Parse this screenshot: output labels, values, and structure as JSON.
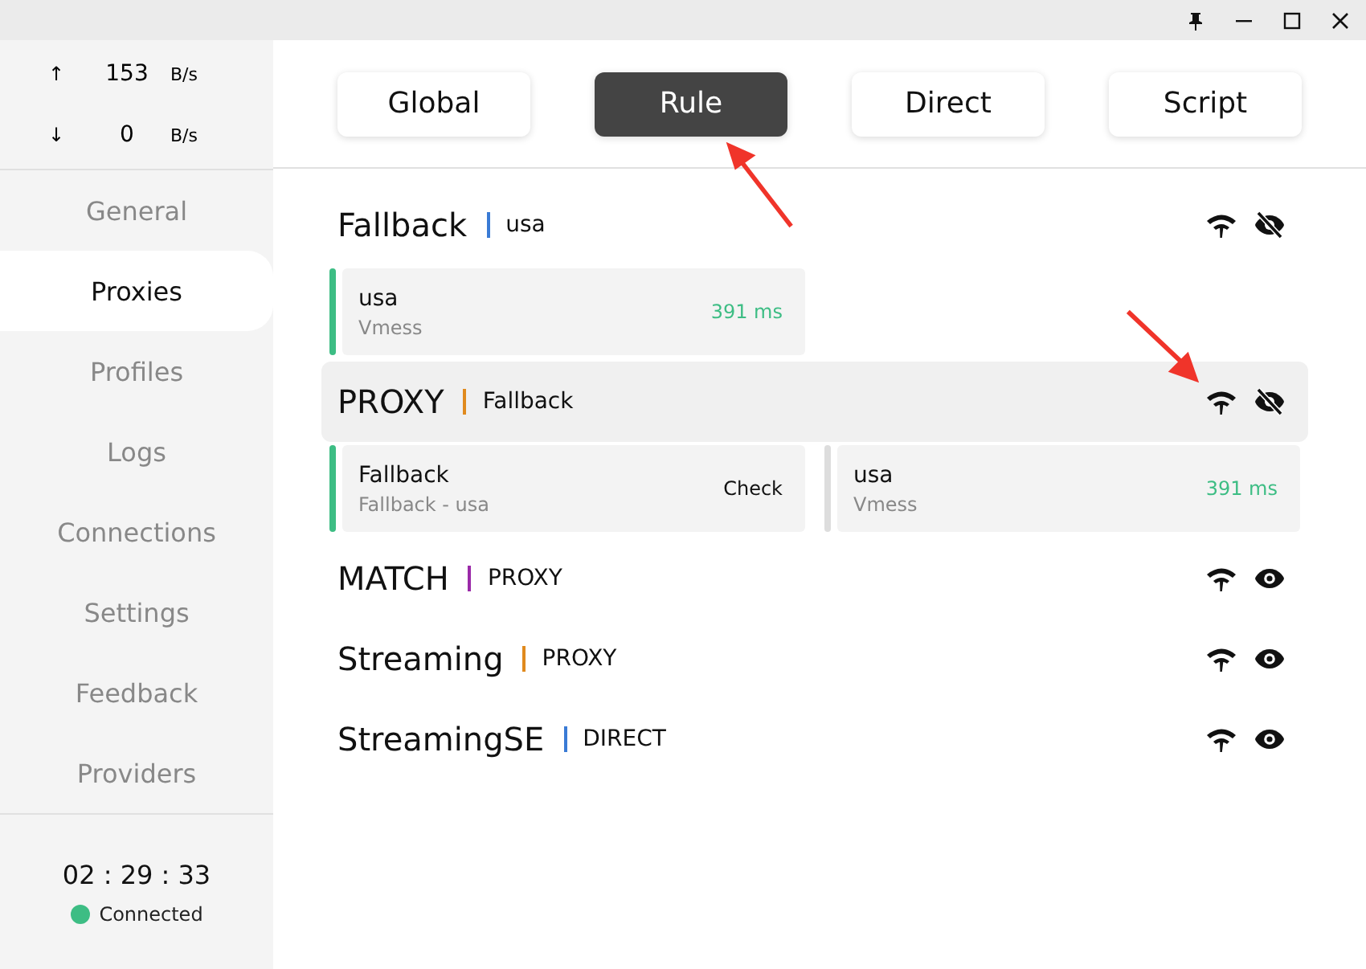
{
  "titlebar": {
    "buttons": [
      {
        "kind": "pin"
      },
      {
        "kind": "minimize"
      },
      {
        "kind": "maximize"
      },
      {
        "kind": "close"
      }
    ]
  },
  "traffic": {
    "up": {
      "arrow": "↑",
      "value": "153",
      "unit": "B/s"
    },
    "down": {
      "arrow": "↓",
      "value": "0",
      "unit": "B/s"
    }
  },
  "sidebar": {
    "items": [
      {
        "label": "General",
        "selected": false
      },
      {
        "label": "Proxies",
        "selected": true
      },
      {
        "label": "Profiles",
        "selected": false
      },
      {
        "label": "Logs",
        "selected": false
      },
      {
        "label": "Connections",
        "selected": false
      },
      {
        "label": "Settings",
        "selected": false
      },
      {
        "label": "Feedback",
        "selected": false
      },
      {
        "label": "Providers",
        "selected": false
      }
    ]
  },
  "status": {
    "uptime": "02 : 29 : 33",
    "label": "Connected",
    "color": "#3dbd84"
  },
  "modes": [
    {
      "label": "Global",
      "selected": false
    },
    {
      "label": "Rule",
      "selected": true
    },
    {
      "label": "Direct",
      "selected": false
    },
    {
      "label": "Script",
      "selected": false
    }
  ],
  "groups": [
    {
      "name": "Fallback",
      "now": "usa",
      "color": "#3a7bd5",
      "hovered": false,
      "expanded": true,
      "proxies": [
        {
          "name": "usa",
          "subtitle": "Vmess",
          "kind": "delay",
          "delay": "391 ms",
          "selected": true
        }
      ]
    },
    {
      "name": "PROXY",
      "now": "Fallback",
      "color": "#e08a1e",
      "hovered": true,
      "expanded": true,
      "proxies": [
        {
          "name": "Fallback",
          "subtitle": "Fallback - usa",
          "kind": "check",
          "delay": "Check",
          "selected": true
        },
        {
          "name": "usa",
          "subtitle": "Vmess",
          "kind": "delay",
          "delay": "391 ms",
          "selected": false
        }
      ]
    },
    {
      "name": "MATCH",
      "now": "PROXY",
      "color": "#9b2aa8",
      "hovered": false,
      "expanded": false
    },
    {
      "name": "Streaming",
      "now": "PROXY",
      "color": "#e08a1e",
      "hovered": false,
      "expanded": false
    },
    {
      "name": "StreamingSE",
      "now": "DIRECT",
      "color": "#3a7bd5",
      "hovered": false,
      "expanded": false
    }
  ]
}
